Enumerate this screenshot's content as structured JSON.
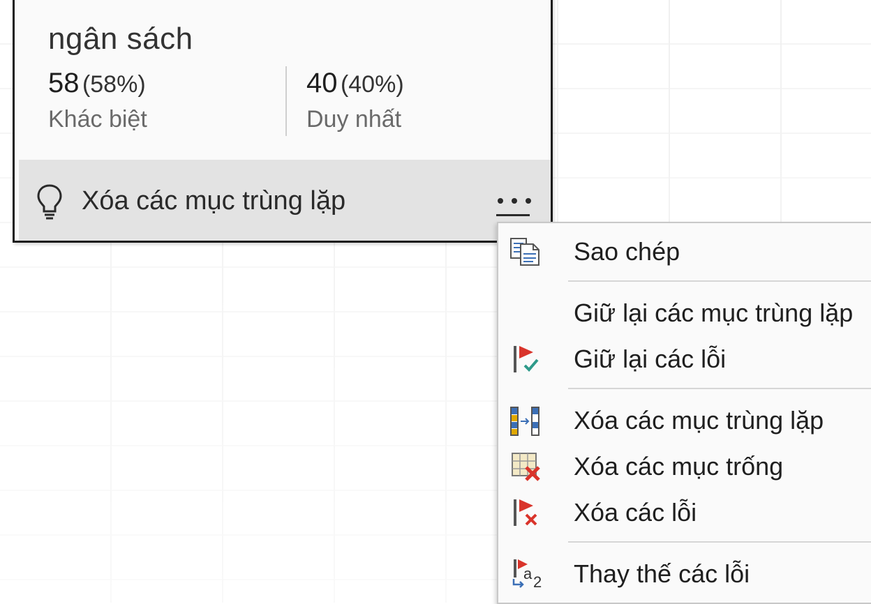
{
  "card": {
    "title": "ngân sách",
    "stats": [
      {
        "value": "58",
        "percent": "(58%)",
        "label": "Khác biệt"
      },
      {
        "value": "40",
        "percent": "(40%)",
        "label": "Duy nhất"
      }
    ],
    "suggestion": {
      "icon": "lightbulb-icon",
      "text": "Xóa các mục trùng lặp"
    },
    "more_icon": "more-options-icon"
  },
  "menu": {
    "items": [
      {
        "label": "Sao chép",
        "icon": "copy-icon"
      },
      {
        "label": "Giữ lại các mục trùng lặp",
        "icon": ""
      },
      {
        "label": "Giữ lại các lỗi",
        "icon": "keep-errors-icon"
      },
      {
        "label": "Xóa các mục trùng lặp",
        "icon": "remove-duplicates-icon"
      },
      {
        "label": "Xóa các mục trống",
        "icon": "remove-empty-icon"
      },
      {
        "label": "Xóa các lỗi",
        "icon": "remove-errors-icon"
      },
      {
        "label": "Thay thế các lỗi",
        "icon": "replace-errors-icon"
      }
    ]
  },
  "colors": {
    "flag_red": "#d9342b",
    "check_teal": "#2e9a8a",
    "column_blue": "#3b6fb6",
    "column_gold": "#e0a800"
  }
}
